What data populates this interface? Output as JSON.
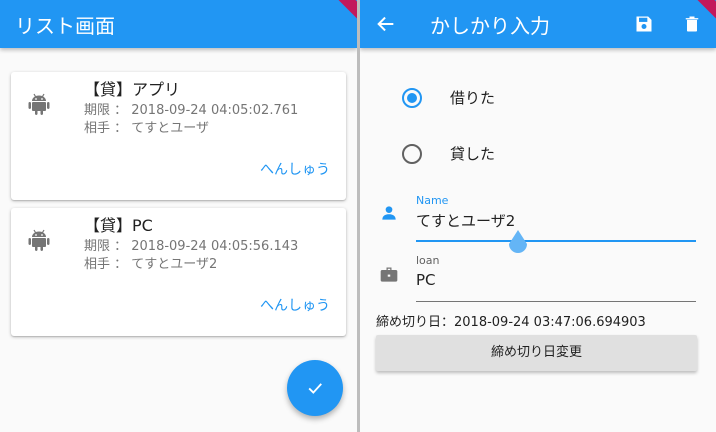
{
  "list_screen": {
    "title": "リスト画面",
    "items": [
      {
        "title": "【貸】アプリ",
        "deadline": "期限 ： 2018-09-24 04:05:02.761",
        "partner": "相手 ： てすとユーザ",
        "edit_label": "へんしゅう"
      },
      {
        "title": "【貸】PC",
        "deadline": "期限 ： 2018-09-24 04:05:56.143",
        "partner": "相手 ： てすとユーザ2",
        "edit_label": "へんしゅう"
      }
    ],
    "fab_icon": "check-icon"
  },
  "input_screen": {
    "title": "かしかり入力",
    "back_icon": "arrow-back-icon",
    "save_icon": "save-icon",
    "delete_icon": "delete-icon",
    "radio_options": [
      {
        "label": "借りた",
        "selected": true
      },
      {
        "label": "貸した",
        "selected": false
      }
    ],
    "name_field": {
      "label": "Name",
      "value": "てすとユーザ2",
      "icon": "person-icon"
    },
    "loan_field": {
      "label": "loan",
      "value": "PC",
      "icon": "briefcase-icon"
    },
    "deadline_text": "締め切り日：2018-09-24 03:47:06.694903",
    "change_deadline_label": "締め切り日変更"
  },
  "colors": {
    "primary": "#2196f3",
    "debug_banner": "#c2185b",
    "icon_gray": "#757575"
  }
}
